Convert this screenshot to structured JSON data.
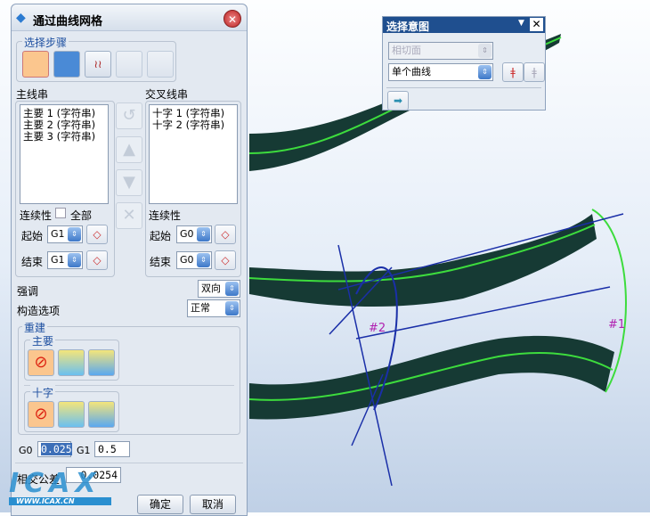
{
  "dialog": {
    "title": "通过曲线网格",
    "steps_label": "选择步骤",
    "primary_label": "主线串",
    "cross_label": "交叉线串",
    "primary_items": [
      "主要 1 (字符串)",
      "主要 2 (字符串)",
      "主要 3 (字符串)"
    ],
    "cross_items": [
      "十字 1 (字符串)",
      "十字 2 (字符串)"
    ],
    "continuity_label": "连续性",
    "all_label": "全部",
    "start_label": "起始",
    "end_label": "结束",
    "primary_start": "G1",
    "primary_end": "G1",
    "cross_start": "G0",
    "cross_end": "G0",
    "emphasis_label": "强调",
    "emphasis_value": "双向",
    "construct_label": "构造选项",
    "construct_value": "正常",
    "rebuild_label": "重建",
    "rebuild_primary": "主要",
    "rebuild_cross": "十字",
    "g0_label": "G0",
    "g0_value": "0.025",
    "g1_label": "G1",
    "g1_value": "0.5",
    "tolerance_label": "相交公差",
    "tolerance_value": "0.0254",
    "ok": "确定",
    "cancel": "取消"
  },
  "intent": {
    "title": "选择意图",
    "face_rule": "相切面",
    "curve_rule": "单个曲线"
  },
  "scene": {
    "label1": "#1",
    "label2": "#2"
  },
  "watermark": {
    "text": "ICAX",
    "url": "WWW.ICAX.CN"
  }
}
